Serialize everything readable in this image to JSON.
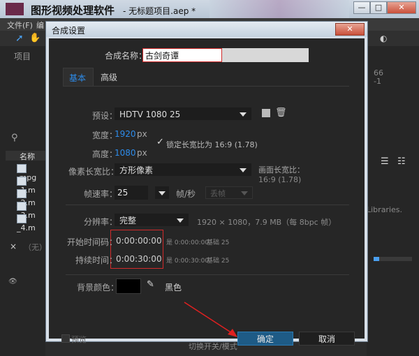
{
  "app": {
    "title": "图形视频处理软件",
    "subtitle": "- 无标题项目.aep *",
    "minimize": "—",
    "maximize": "□",
    "close": "✕"
  },
  "menu": {
    "file": "文件(F)",
    "edit": "编"
  },
  "project_panel": {
    "tab": "项目",
    "search_icon": "⚲",
    "column_name": "名称",
    "files": [
      ".mpg",
      "_1.m",
      "_2.m",
      "_3.m",
      "_4.m"
    ],
    "none_label": "（无）"
  },
  "right_panel": {
    "value1": "66",
    "value2": "-1",
    "libraries_text": "Libraries.",
    "bottom_label": "切换开关/模式"
  },
  "dialog": {
    "title": "合成设置",
    "close": "✕",
    "comp_name_label": "合成名称：",
    "comp_name_value": "古剑奇谭",
    "tabs": [
      {
        "label": "基本",
        "active": true
      },
      {
        "label": "高级",
        "active": false
      }
    ],
    "preset_label": "预设：",
    "preset_value": "HDTV 1080 25",
    "width_label": "宽度：",
    "width_value": "1920",
    "width_unit": "px",
    "height_label": "高度：",
    "height_value": "1080",
    "height_unit": "px",
    "lock_aspect_checked": true,
    "lock_aspect_label": "锁定长宽比为 16:9 (1.78)",
    "pixel_aspect_label": "像素长宽比：",
    "pixel_aspect_value": "方形像素",
    "frame_aspect_label": "画面长宽比：",
    "frame_aspect_value": "16:9 (1.78)",
    "frame_rate_label": "帧速率：",
    "frame_rate_value": "25",
    "frame_rate_unit": "帧/秒",
    "drop_frame_value": "丢帧",
    "resolution_label": "分辨率：",
    "resolution_value": "完整",
    "resolution_info": "1920 × 1080，7.9 MB（每 8bpc 帧）",
    "start_timecode_label": "开始时间码：",
    "start_timecode_value": "0:00:00:00",
    "start_timecode_info": "是 0:00:00:00",
    "start_timecode_base": "基础 25",
    "duration_label": "持续时间：",
    "duration_value": "0:00:30:00",
    "duration_info": "是 0:00:30:00",
    "duration_base": "基础 25",
    "bg_color_label": "背景颜色：",
    "bg_color_name": "黑色",
    "preview_label": "预览",
    "ok_label": "确定",
    "cancel_label": "取消"
  },
  "colors": {
    "dialog_bg": "#262626",
    "accent_blue": "#2d8ceb",
    "ok_button": "#1e5b86",
    "highlight_red": "#d12a2a",
    "bg_swatch": "#000000"
  }
}
